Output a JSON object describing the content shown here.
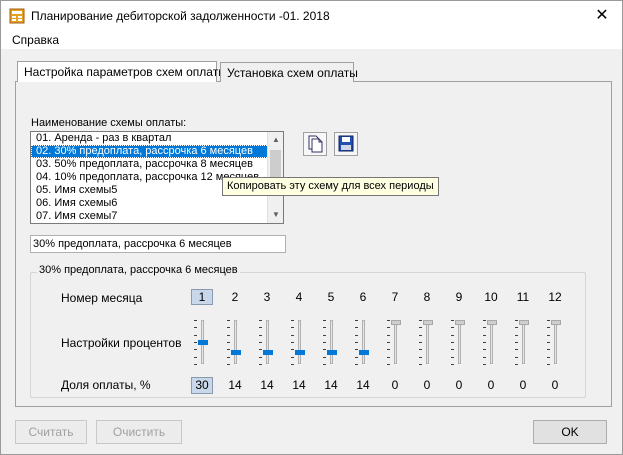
{
  "window": {
    "title": "Планирование дебиторской задолженности -01. 2018",
    "close_glyph": "✕"
  },
  "menu": {
    "help": "Справка"
  },
  "tabs": [
    {
      "label": "Настройка параметров схем оплаты",
      "active": true
    },
    {
      "label": "Установка схем оплаты",
      "active": false
    }
  ],
  "scheme_list": {
    "label": "Наименование схемы оплаты:",
    "items": [
      "01. Аренда - раз в квартал",
      "02. 30% предоплата, рассрочка 6 месяцев",
      "03. 50% предоплата, рассрочка 8 месяцев",
      "04. 10% предоплата, рассрочка 12 месяцев",
      "05. Имя схемы5",
      "06. Имя схемы6",
      "07. Имя схемы7"
    ],
    "selected_index": 1
  },
  "toolbar": {
    "copy_icon": "copy-icon",
    "save_icon": "save-icon"
  },
  "tooltip": "Копировать эту схему для всех периоды",
  "scheme_name_value": "30% предоплата, рассрочка 6 месяцев",
  "group": {
    "title": "30% предоплата, рассрочка 6 месяцев",
    "month_label": "Номер месяца",
    "percent_label": "Настройки процентов",
    "share_label": "Доля оплаты, %",
    "months": [
      "1",
      "2",
      "3",
      "4",
      "5",
      "6",
      "7",
      "8",
      "9",
      "10",
      "11",
      "12"
    ],
    "shares": [
      "30",
      "14",
      "14",
      "14",
      "14",
      "14",
      "0",
      "0",
      "0",
      "0",
      "0",
      "0"
    ]
  },
  "buttons": {
    "calc": "Считать",
    "clear": "Очистить",
    "ok": "OK"
  },
  "colors": {
    "selection": "#0078d7",
    "tooltip_bg": "#ffffe1",
    "window_bg": "#f0f0f0"
  }
}
